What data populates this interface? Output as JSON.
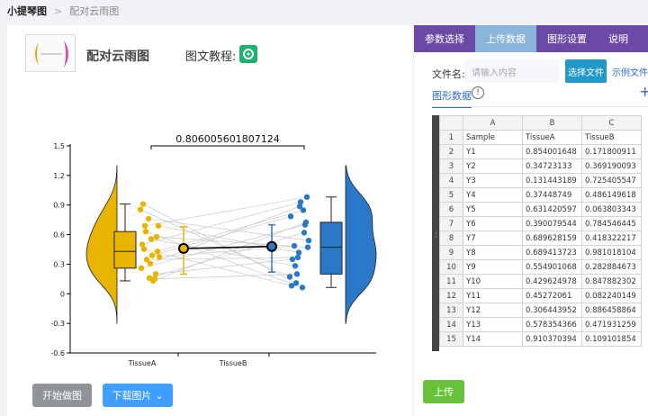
{
  "breadcrumb": {
    "home": "小提琴图",
    "separator": ">",
    "current": "配对云雨图"
  },
  "header": {
    "title": "配对云雨图",
    "tutorial_label": "图文教程:"
  },
  "buttons": {
    "start": "开始做图",
    "download": "下载图片",
    "choose_file": "选择文件",
    "example_file": "示例文件",
    "upload": "上传"
  },
  "tabs": [
    {
      "label": "参数选择"
    },
    {
      "label": "上传数据"
    },
    {
      "label": "图形设置"
    },
    {
      "label": "说明"
    }
  ],
  "upload": {
    "file_label": "文件名:",
    "file_placeholder": "请输入内容",
    "data_tab": "图形数据",
    "info_glyph": "!",
    "plus_glyph": "+"
  },
  "sheet": {
    "columns": [
      "",
      "A",
      "B",
      "C"
    ],
    "rows": [
      [
        "1",
        "Sample",
        "TissueA",
        "TissueB"
      ],
      [
        "2",
        "Y1",
        "0.854001648",
        "0.171800911"
      ],
      [
        "3",
        "Y2",
        "0.34723133",
        "0.369190093"
      ],
      [
        "4",
        "Y3",
        "0.131443189",
        "0.725405547"
      ],
      [
        "5",
        "Y4",
        "0.37448749",
        "0.486149618"
      ],
      [
        "6",
        "Y5",
        "0.631420597",
        "0.063803343"
      ],
      [
        "7",
        "Y6",
        "0.390079544",
        "0.784546445"
      ],
      [
        "8",
        "Y7",
        "0.689628159",
        "0.418322217"
      ],
      [
        "9",
        "Y8",
        "0.689413723",
        "0.981018104"
      ],
      [
        "10",
        "Y9",
        "0.554901068",
        "0.282884673"
      ],
      [
        "11",
        "Y10",
        "0.429624978",
        "0.847882302"
      ],
      [
        "12",
        "Y11",
        "0.45272061",
        "0.082240149"
      ],
      [
        "13",
        "Y12",
        "0.306443952",
        "0.886458864"
      ],
      [
        "14",
        "Y13",
        "0.578354366",
        "0.471931259"
      ],
      [
        "15",
        "Y14",
        "0.910370394",
        "0.109101854"
      ]
    ]
  },
  "chart_data": {
    "type": "scatter",
    "annotation": "0.806005601807124",
    "categories": [
      "TissueA",
      "TissueB"
    ],
    "ylim": [
      -0.6,
      1.5
    ],
    "yticks": [
      "1.5",
      "1.2",
      "0.9",
      "0.6",
      "0.3",
      "0",
      "-0.3",
      "-0.6"
    ],
    "series": [
      {
        "values": [
          0.854,
          0.347,
          0.131,
          0.374,
          0.631,
          0.39,
          0.69,
          0.689,
          0.555,
          0.43,
          0.453,
          0.306,
          0.578,
          0.91,
          0.16,
          0.2,
          0.5,
          0.76,
          0.15,
          0.26
        ]
      },
      {
        "values": [
          0.172,
          0.369,
          0.725,
          0.486,
          0.064,
          0.785,
          0.418,
          0.981,
          0.283,
          0.848,
          0.082,
          0.886,
          0.472,
          0.109,
          0.62,
          0.35,
          0.93,
          0.54,
          0.2,
          0.7
        ]
      }
    ],
    "means": [
      0.46,
      0.48
    ],
    "colors": {
      "a": "#e8b400",
      "b": "#2a78c8"
    }
  }
}
